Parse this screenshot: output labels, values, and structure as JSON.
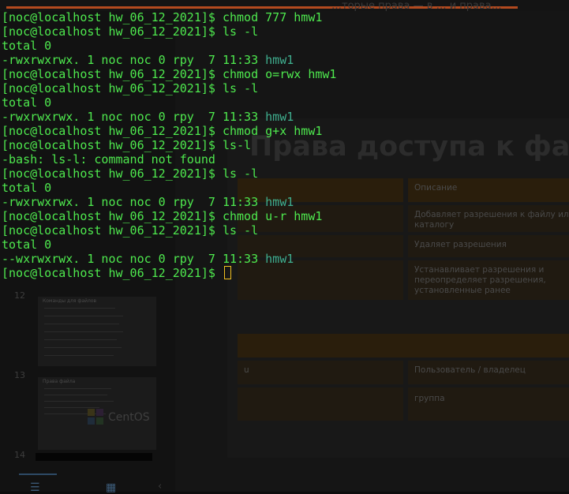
{
  "background": {
    "top_text": "…торые права — в … и права…",
    "slide_numbers": [
      "12",
      "13",
      "14"
    ],
    "thumb_12_title": "Команды для файлов",
    "thumb_13_title": "Права файла",
    "centos_label": "CentOS",
    "slide": {
      "title": "Права доступа к фай",
      "rows": [
        {
          "c1": "",
          "c2": "Описание"
        },
        {
          "c1": "",
          "c2": "Добавляет разрешения к файлу или\nкаталогу"
        },
        {
          "c1": "",
          "c2": "Удаляет разрешения"
        },
        {
          "c1": "",
          "c2": "Устанавливает разрешения и\nпереопределяет разрешения,\nустановленные ранее"
        }
      ],
      "band_text": "",
      "rows2": [
        {
          "c1": "u",
          "c2": "Пользователь / владелец"
        },
        {
          "c1": "",
          "c2": "группа"
        }
      ]
    },
    "colors": {
      "accent": "#b34a1f",
      "terminal_text": "#4ee94e",
      "filename": "#3fae8e",
      "cursor": "#f0c020"
    }
  },
  "terminal": {
    "lines": [
      {
        "segments": [
          {
            "text": "[noc@localhost hw_06_12_2021]$ chmod 777 hmw1",
            "style": "green"
          }
        ]
      },
      {
        "segments": [
          {
            "text": "[noc@localhost hw_06_12_2021]$ ls -l",
            "style": "green"
          }
        ]
      },
      {
        "segments": [
          {
            "text": "total 0",
            "style": "green"
          }
        ]
      },
      {
        "segments": [
          {
            "text": "-rwxrwxrwx. 1 noc noc 0 rpy  7 11:33 ",
            "style": "green"
          },
          {
            "text": "hmw1",
            "style": "cyan"
          }
        ]
      },
      {
        "segments": [
          {
            "text": "[noc@localhost hw_06_12_2021]$ chmod o=rwx hmw1",
            "style": "green"
          }
        ]
      },
      {
        "segments": [
          {
            "text": "[noc@localhost hw_06_12_2021]$ ls -l",
            "style": "green"
          }
        ]
      },
      {
        "segments": [
          {
            "text": "total 0",
            "style": "green"
          }
        ]
      },
      {
        "segments": [
          {
            "text": "-rwxrwxrwx. 1 noc noc 0 rpy  7 11:33 ",
            "style": "green"
          },
          {
            "text": "hmw1",
            "style": "cyan"
          }
        ]
      },
      {
        "segments": [
          {
            "text": "[noc@localhost hw_06_12_2021]$ chmod g+x hmw1",
            "style": "green"
          }
        ]
      },
      {
        "segments": [
          {
            "text": "[noc@localhost hw_06_12_2021]$ ls-l",
            "style": "green"
          }
        ]
      },
      {
        "segments": [
          {
            "text": "-bash: ls-l: command not found",
            "style": "green"
          }
        ]
      },
      {
        "segments": [
          {
            "text": "[noc@localhost hw_06_12_2021]$ ls -l",
            "style": "green"
          }
        ]
      },
      {
        "segments": [
          {
            "text": "total 0",
            "style": "green"
          }
        ]
      },
      {
        "segments": [
          {
            "text": "-rwxrwxrwx. 1 noc noc 0 rpy  7 11:33 ",
            "style": "green"
          },
          {
            "text": "hmw1",
            "style": "cyan"
          }
        ]
      },
      {
        "segments": [
          {
            "text": "[noc@localhost hw_06_12_2021]$ chmod u-r hmw1",
            "style": "green"
          }
        ]
      },
      {
        "segments": [
          {
            "text": "[noc@localhost hw_06_12_2021]$ ls -l",
            "style": "green"
          }
        ]
      },
      {
        "segments": [
          {
            "text": "total 0",
            "style": "green"
          }
        ]
      },
      {
        "segments": [
          {
            "text": "--wxrwxrwx. 1 noc noc 0 rpy  7 11:33 ",
            "style": "green"
          },
          {
            "text": "hmw1",
            "style": "cyan"
          }
        ]
      },
      {
        "segments": [
          {
            "text": "[noc@localhost hw_06_12_2021]$ ",
            "style": "green"
          }
        ],
        "cursor": true
      }
    ]
  }
}
